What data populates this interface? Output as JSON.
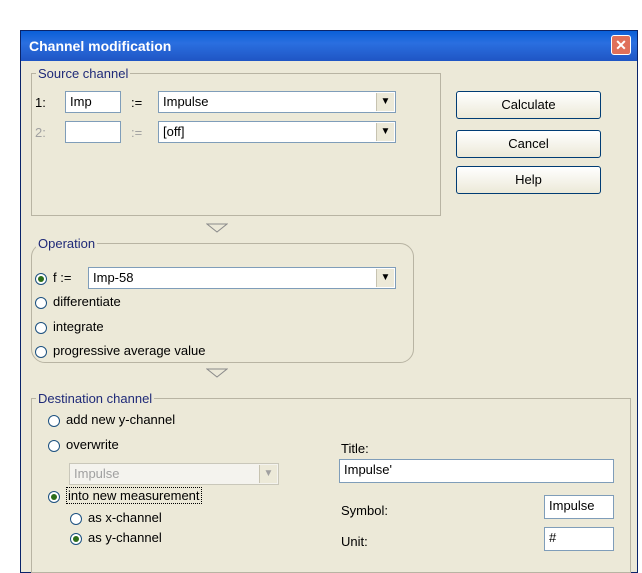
{
  "window": {
    "title": "Channel modification",
    "close_symbol": "✕"
  },
  "source": {
    "legend": "Source channel",
    "row1": {
      "index": "1:",
      "channel": "Imp",
      "assign": ":=",
      "value": "Impulse"
    },
    "row2": {
      "index": "2:",
      "channel": "",
      "assign": ":=",
      "value": "[off]"
    }
  },
  "buttons": {
    "calculate": "Calculate",
    "cancel": "Cancel",
    "help": "Help"
  },
  "operation": {
    "legend": "Operation",
    "formula_prefix": "f :=",
    "formula_value": "Imp-58",
    "options": {
      "differentiate": "differentiate",
      "integrate": "integrate",
      "progressive": "progressive average value"
    }
  },
  "destination": {
    "legend": "Destination channel",
    "add_new": "add new y-channel",
    "overwrite": "overwrite",
    "overwrite_select": "Impulse",
    "into_new": "into new measurement",
    "as_x": "as x-channel",
    "as_y": "as y-channel",
    "title_label": "Title:",
    "title_value": "Impulse'",
    "symbol_label": "Symbol:",
    "symbol_value": "Impulse",
    "unit_label": "Unit:",
    "unit_value": "#"
  },
  "icons": {
    "dropdown": "▼"
  },
  "colors": {
    "titlebar": "#1f55c4",
    "dialog_bg": "#ece9d8",
    "legend_text": "#1f2a78"
  }
}
